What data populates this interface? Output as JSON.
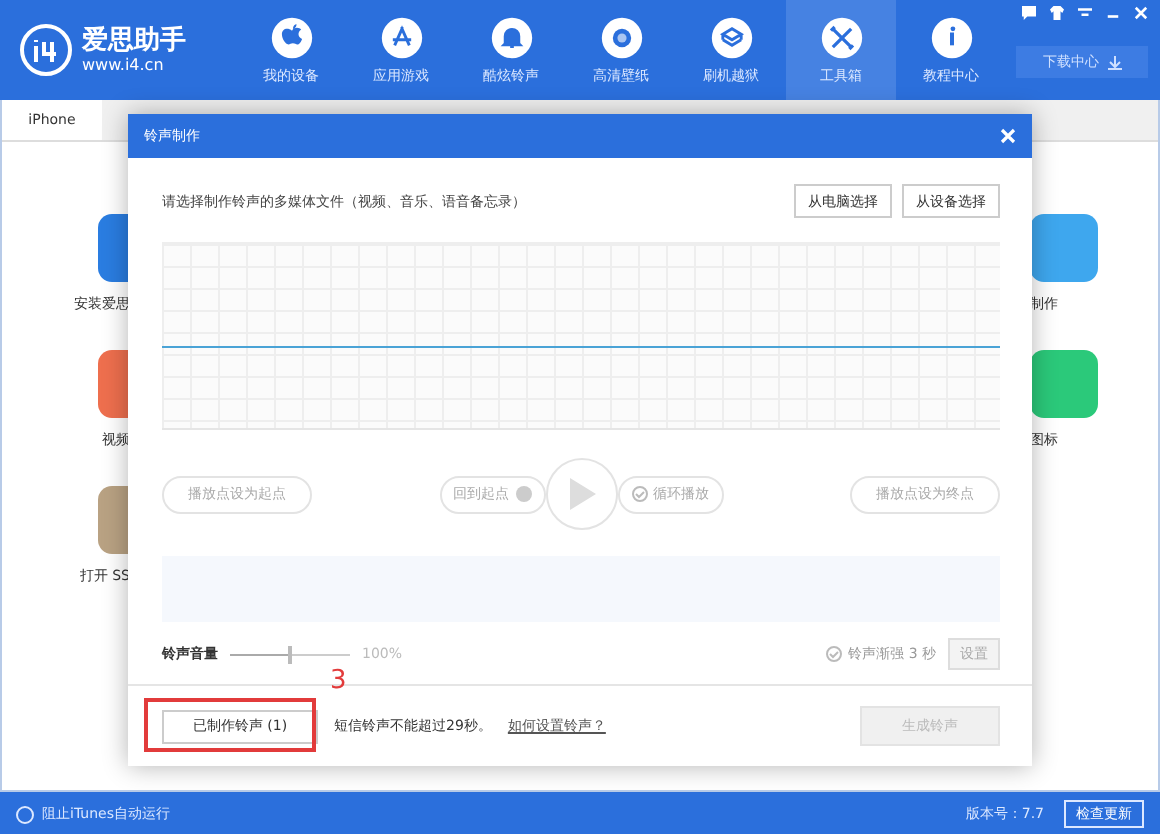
{
  "app": {
    "logo_name": "爱思助手",
    "logo_url": "www.i4.cn",
    "download_center": "下载中心"
  },
  "nav": [
    {
      "label": "我的设备",
      "selected": false
    },
    {
      "label": "应用游戏",
      "selected": false
    },
    {
      "label": "酷炫铃声",
      "selected": false
    },
    {
      "label": "高清壁纸",
      "selected": false
    },
    {
      "label": "刷机越狱",
      "selected": false
    },
    {
      "label": "工具箱",
      "selected": true
    },
    {
      "label": "教程中心",
      "selected": false
    }
  ],
  "device_tab": {
    "label": "iPhone",
    "selected": true
  },
  "tools_left": [
    {
      "label": "安装爱思",
      "color": "#2a7de1"
    },
    {
      "label": "视频",
      "color": "#ee6f4e"
    },
    {
      "label": "打开 SS",
      "color": "#b9a283"
    }
  ],
  "tools_right": [
    {
      "label": "制作",
      "color": "#3ea7ee"
    },
    {
      "label": "图标",
      "color": "#2bc97a"
    }
  ],
  "dialog": {
    "title": "铃声制作",
    "prompt": "请选择制作铃声的多媒体文件（视频、音乐、语音备忘录）",
    "source_buttons": [
      "从电脑选择",
      "从设备选择"
    ],
    "set_start": "播放点设为起点",
    "back_to_start": "回到起点",
    "loop": "循环播放",
    "set_end": "播放点设为终点",
    "volume": {
      "label": "铃声音量",
      "level": 0.5,
      "reading": "100%"
    },
    "fade_in": {
      "label": "铃声渐强 3 秒",
      "checked": false
    },
    "settings_button": "设置",
    "made_button": "已制作铃声 (1)",
    "note": "短信铃声不能超过29秒。",
    "help_link": "如何设置铃声？",
    "generate_button": {
      "label": "生成铃声",
      "disabled": true
    }
  },
  "annotation": {
    "label": "3"
  },
  "status_bar": {
    "itunes": "阻止iTunes自动运行",
    "version": "版本号：7.7",
    "update": "检查更新"
  }
}
